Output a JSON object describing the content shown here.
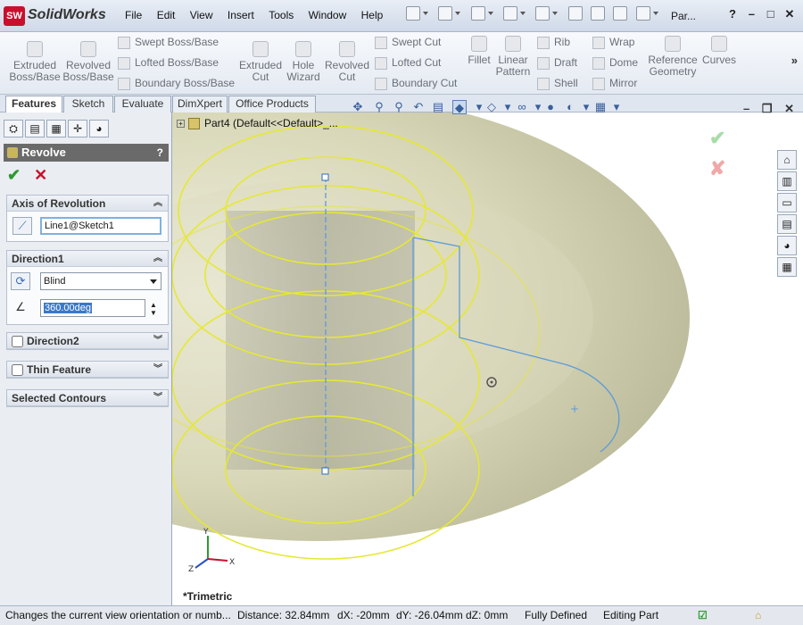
{
  "app": {
    "logo_badge": "SW",
    "name": "SolidWorks",
    "doc_title": "Par..."
  },
  "menu": [
    "File",
    "Edit",
    "View",
    "Insert",
    "Tools",
    "Window",
    "Help"
  ],
  "ribbon": {
    "extruded_boss": "Extruded\nBoss/Base",
    "revolved_boss": "Revolved\nBoss/Base",
    "swept_boss": "Swept Boss/Base",
    "lofted_boss": "Lofted Boss/Base",
    "boundary_boss": "Boundary Boss/Base",
    "extruded_cut": "Extruded\nCut",
    "hole_wizard": "Hole\nWizard",
    "revolved_cut": "Revolved\nCut",
    "swept_cut": "Swept Cut",
    "lofted_cut": "Lofted Cut",
    "boundary_cut": "Boundary Cut",
    "fillet": "Fillet",
    "linear_pattern": "Linear\nPattern",
    "rib": "Rib",
    "draft": "Draft",
    "shell": "Shell",
    "wrap": "Wrap",
    "dome": "Dome",
    "mirror": "Mirror",
    "reference_geometry": "Reference\nGeometry",
    "curves": "Curves"
  },
  "tabs": [
    "Features",
    "Sketch",
    "Evaluate",
    "DimXpert",
    "Office Products"
  ],
  "panel": {
    "title": "Revolve",
    "help": "?",
    "axis": {
      "header": "Axis of Revolution",
      "value": "Line1@Sketch1"
    },
    "direction1": {
      "header": "Direction1",
      "type": "Blind",
      "angle": "360.00deg"
    },
    "direction2": {
      "header": "Direction2"
    },
    "thin": {
      "header": "Thin Feature"
    },
    "contours": {
      "header": "Selected Contours"
    }
  },
  "tree": {
    "label": "Part4  (Default<<Default>_..."
  },
  "viewport": {
    "orientation": "*Trimetric",
    "axes": {
      "x": "X",
      "y": "Y",
      "z": "Z"
    }
  },
  "status": {
    "hint": "Changes the current view orientation or numb...",
    "distance": "Distance: 32.84mm",
    "dx": "dX: -20mm",
    "dy": "dY: -26.04mm",
    "dz": "dZ: 0mm",
    "state": "Fully Defined",
    "mode": "Editing Part"
  },
  "colors": {
    "preview": "#d8d6b4",
    "edge": "#e6e832",
    "accent": "#3a78c8"
  }
}
